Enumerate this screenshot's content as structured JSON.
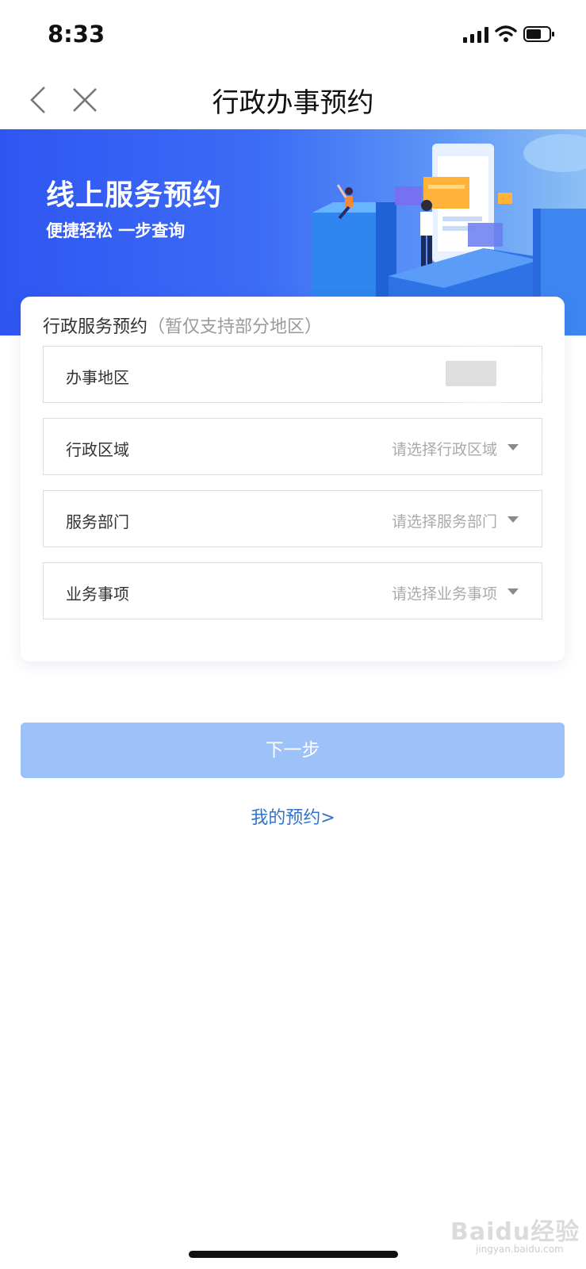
{
  "status_bar": {
    "time": "8:33"
  },
  "nav": {
    "title": "行政办事预约"
  },
  "banner": {
    "title": "线上服务预约",
    "subtitle": "便捷轻松 一步查询"
  },
  "form": {
    "heading": "行政服务预约",
    "heading_hint": "（暂仅支持部分地区）",
    "fields": [
      {
        "label": "办事地区",
        "value": ""
      },
      {
        "label": "行政区域",
        "placeholder": "请选择行政区域"
      },
      {
        "label": "服务部门",
        "placeholder": "请选择服务部门"
      },
      {
        "label": "业务事项",
        "placeholder": "请选择业务事项"
      }
    ]
  },
  "actions": {
    "next_label": "下一步",
    "my_appointments_label": "我的预约>"
  },
  "watermark": {
    "text": "Baidu经验",
    "sub": "jingyan.baidu.com"
  },
  "colors": {
    "banner_start": "#2f56f2",
    "banner_end": "#8cc0f5",
    "button_disabled": "#9dc1f9",
    "link": "#2f74c9"
  }
}
